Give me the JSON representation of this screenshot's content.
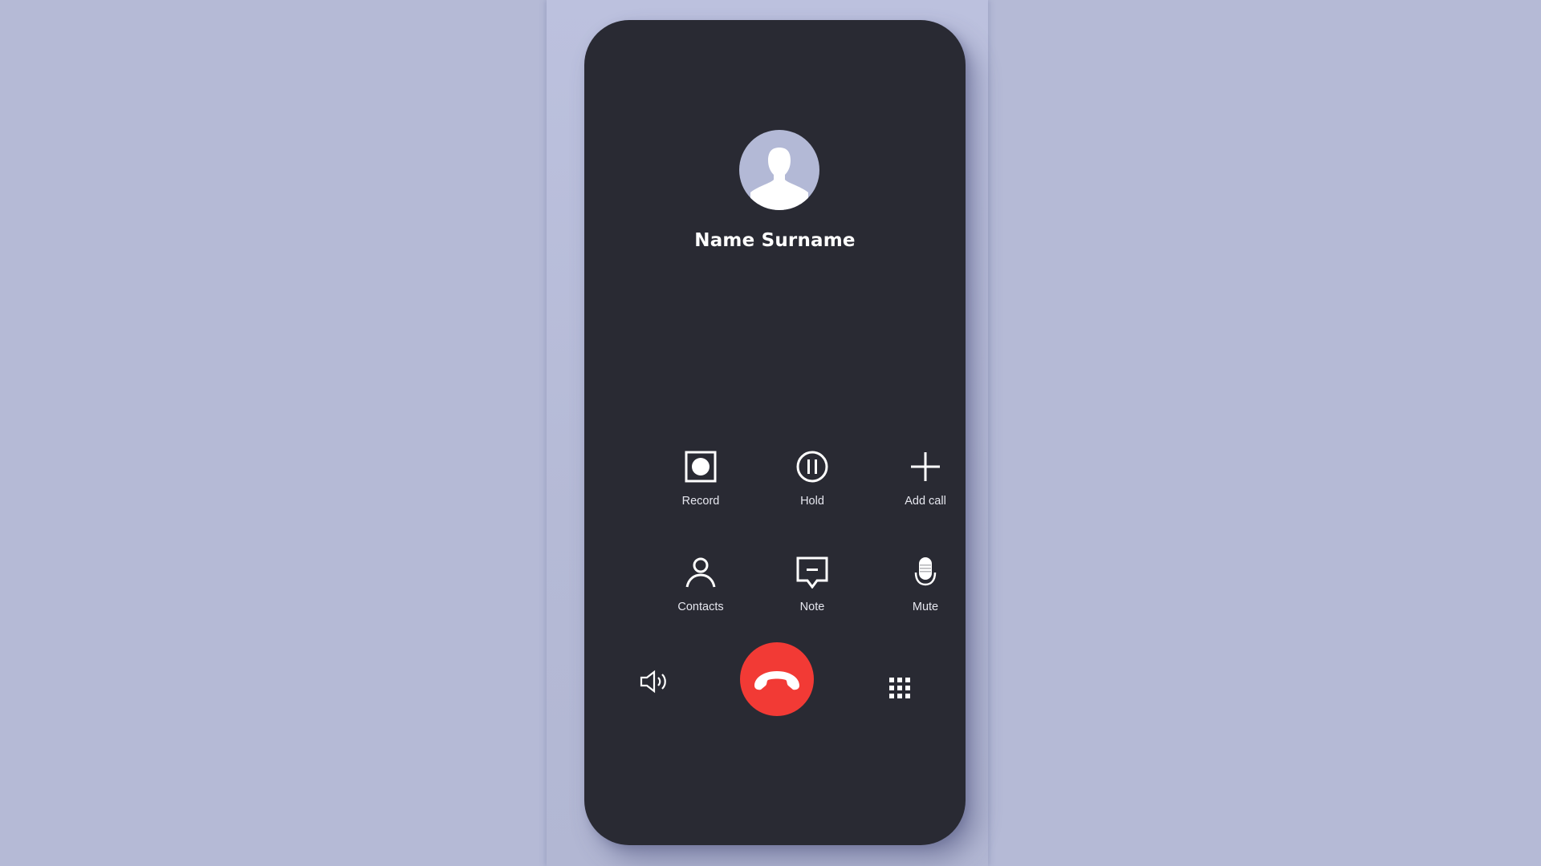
{
  "caller": {
    "name": "Name Surname"
  },
  "controls": [
    {
      "label": "Record",
      "icon": "record-icon"
    },
    {
      "label": "Hold",
      "icon": "pause-icon"
    },
    {
      "label": "Add call",
      "icon": "plus-icon"
    },
    {
      "label": "Contacts",
      "icon": "person-icon"
    },
    {
      "label": "Note",
      "icon": "note-icon"
    },
    {
      "label": "Mute",
      "icon": "microphone-icon"
    }
  ],
  "bottom_bar": {
    "speaker_icon": "speaker-icon",
    "end_call_icon": "phone-hangup-icon",
    "keypad_icon": "keypad-icon"
  },
  "colors": {
    "background": "#b5bad6",
    "phone_body": "#292a33",
    "end_call": "#f23a35",
    "avatar": "#b3b9d6"
  }
}
